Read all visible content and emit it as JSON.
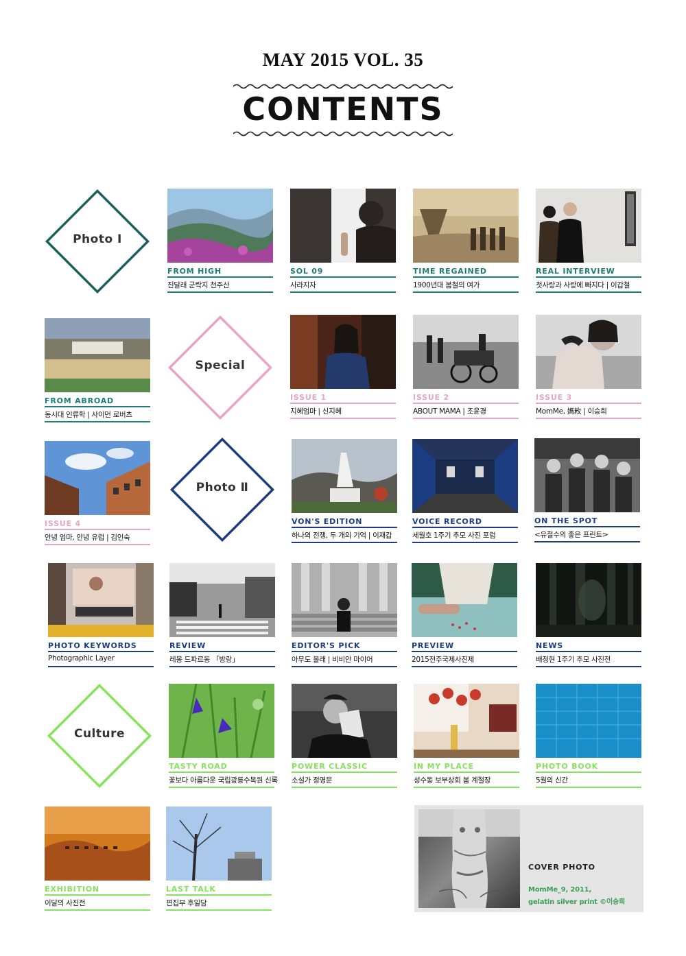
{
  "header": {
    "issue": "MAY 2015 VOL. 35",
    "title": "CONTENTS"
  },
  "sections": [
    {
      "label": "Photo Ⅰ",
      "color": "#1d5f5c"
    },
    {
      "label": "Special",
      "color": "#e7a4c4"
    },
    {
      "label": "Photo Ⅱ",
      "color": "#1c3c82"
    },
    {
      "label": "Culture",
      "color": "#86e35c"
    }
  ],
  "articles": [
    {
      "category": "FROM HIGH",
      "title": "진달래 군락지 천주산",
      "color": "#1e7d74",
      "image": "mountain-landscape"
    },
    {
      "category": "SOL 09",
      "title": "사라지자",
      "color": "#1e7d74",
      "image": "window-silhouette"
    },
    {
      "category": "TIME REGAINED",
      "title": "1900년대 봄철의 여가",
      "color": "#1e7d74",
      "image": "sepia-historic-photo"
    },
    {
      "category": "REAL INTERVIEW",
      "title": "첫사랑과 사랑에 빠지다 | 이갑철",
      "color": "#1e7d74",
      "image": "gallery-people"
    },
    {
      "category": "FROM ABROAD",
      "title": "동시대 인류학 | 사이먼 로버츠",
      "color": "#1e7d74",
      "image": "stadium-aerial"
    },
    {
      "category": "ISSUE 1",
      "title": "지혜엄마 | 신지혜",
      "color": "#e7a4c4",
      "image": "woman-portrait"
    },
    {
      "category": "ISSUE 2",
      "title": "ABOUT MAMA | 조윤경",
      "color": "#e7a4c4",
      "image": "street-bw"
    },
    {
      "category": "ISSUE 3",
      "title": "MomMe, 媽敉 | 이승희",
      "color": "#e7a4c4",
      "image": "mother-embrace"
    },
    {
      "category": "ISSUE 4",
      "title": "안녕 엄마, 안녕 유럽 | 김인숙",
      "color": "#e7a4c4",
      "image": "building-sky"
    },
    {
      "category": "VON'S EDITION",
      "title": "하나의 전쟁, 두 개의 기억 | 이재갑",
      "color": "#1c3c82",
      "image": "war-memorial"
    },
    {
      "category": "VOICE RECORD",
      "title": "세월호 1주기 추모 사진 포럼",
      "color": "#1c3c82",
      "image": "exhibition-hall"
    },
    {
      "category": "ON THE SPOT",
      "title": "<유철수의 좋은 프린트>",
      "color": "#1c3c82",
      "image": "children-bw"
    },
    {
      "category": "PHOTO KEYWORDS",
      "title": "Photographic Layer",
      "color": "#1c3c82",
      "image": "city-billboard"
    },
    {
      "category": "REVIEW",
      "title": "레몽 드파르동 「방랑」",
      "color": "#1c3c82",
      "image": "crosswalk-bw"
    },
    {
      "category": "EDITOR'S PICK",
      "title": "아무도 몰래 | 비비안 마이어",
      "color": "#1c3c82",
      "image": "library-steps-bw"
    },
    {
      "category": "PREVIEW",
      "title": "2015전주국제사진제",
      "color": "#1c3c82",
      "image": "table-petals"
    },
    {
      "category": "NEWS",
      "title": "배정현 1주기 추모 사진전",
      "color": "#1c3c82",
      "image": "dark-forest"
    },
    {
      "category": "TASTY ROAD",
      "title": "꽃보다 아름다운 국립광릉수목원 신록",
      "color": "#86e35c",
      "image": "iris-flowers"
    },
    {
      "category": "POWER CLASSIC",
      "title": "소설가 정영문",
      "color": "#86e35c",
      "image": "man-with-book"
    },
    {
      "category": "IN MY PLACE",
      "title": "성수동 보부상회 봄 계절장",
      "color": "#86e35c",
      "image": "cafe-flowers"
    },
    {
      "category": "PHOTO BOOK",
      "title": "5월의 신간",
      "color": "#86e35c",
      "image": "blue-building"
    },
    {
      "category": "EXHIBITION",
      "title": "이달의 사진전",
      "color": "#86e35c",
      "image": "desert-caravan"
    },
    {
      "category": "LAST TALK",
      "title": "편집부 후일담",
      "color": "#86e35c",
      "image": "tree-sky"
    }
  ],
  "cover": {
    "heading": "COVER PHOTO",
    "caption_line1": "MomMe_9, 2011,",
    "caption_line2": "gelatin silver print ©이승희",
    "image": "cover-bw-figure"
  }
}
